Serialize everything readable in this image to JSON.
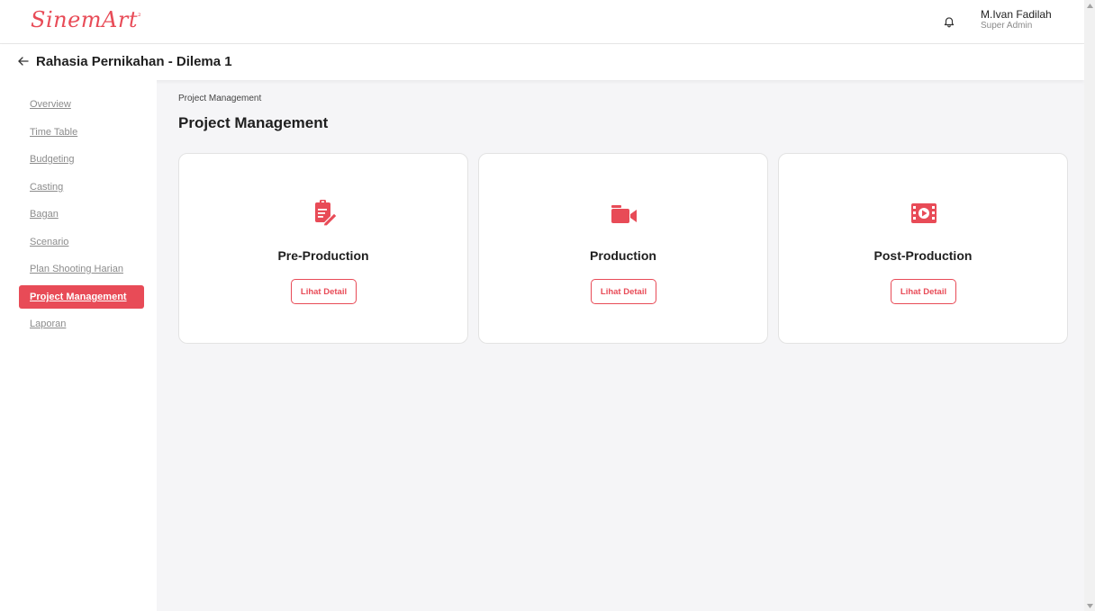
{
  "header": {
    "logo_text": "SinemArt",
    "logo_mark": "²",
    "user_name": "M.Ivan Fadilah",
    "user_role": "Super Admin"
  },
  "project": {
    "title": "Rahasia Pernikahan - Dilema 1"
  },
  "sidebar": {
    "items": [
      {
        "label": "Overview"
      },
      {
        "label": "Time Table"
      },
      {
        "label": "Budgeting"
      },
      {
        "label": "Casting"
      },
      {
        "label": "Bagan"
      },
      {
        "label": "Scenario"
      },
      {
        "label": "Plan Shooting Harian"
      },
      {
        "label": "Project Management",
        "active": true
      },
      {
        "label": "Laporan"
      }
    ]
  },
  "main": {
    "breadcrumb": "Project Management",
    "title": "Project Management",
    "cards": [
      {
        "title": "Pre-Production",
        "icon": "clipboard-edit-icon",
        "button": "Lihat Detail"
      },
      {
        "title": "Production",
        "icon": "video-camera-icon",
        "button": "Lihat Detail"
      },
      {
        "title": "Post-Production",
        "icon": "film-play-icon",
        "button": "Lihat Detail"
      }
    ]
  },
  "colors": {
    "accent": "#e84b57",
    "background": "#f5f5f7"
  }
}
